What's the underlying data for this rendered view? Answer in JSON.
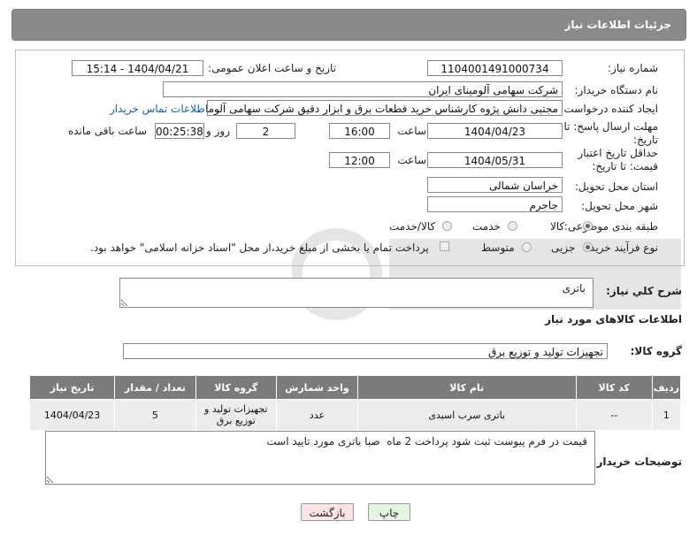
{
  "header": {
    "title": "جزئیات اطلاعات نیاز"
  },
  "form": {
    "need_number_label": "شماره نیاز:",
    "need_number": "1104001491000734",
    "announce_label": "تاریخ و ساعت اعلان عمومی:",
    "announce_value": "1404/04/21 - 15:14",
    "buyer_org_label": "نام دستگاه خریدار:",
    "buyer_org": "شرکت سهامی آلومینای ایران",
    "requester_label": "ایجاد کننده درخواست:",
    "requester": "مجتبی دانش پژوه کارشناس خرید قطعات برق و ابزار دقیق شرکت سهامی آلومینای ایران",
    "contact_link": "اطلاعات تماس خریدار",
    "reply_deadline_label": "مهلت ارسال پاسخ: تا تاریخ:",
    "reply_date": "1404/04/23",
    "time_label": "ساعت",
    "reply_time": "16:00",
    "days_value": "2",
    "days_label": "روز و",
    "remaining_value": "00:25:38",
    "remaining_label": "ساعت باقی مانده",
    "price_validity_label": "حداقل تاریخ اعتبار قیمت: تا تاریخ:",
    "price_date": "1404/05/31",
    "price_time": "12:00",
    "province_label": "استان محل تحویل:",
    "province": "خراسان شمالی",
    "city_label": "شهر محل تحویل:",
    "city": "جاجرم",
    "category_label": "طبقه بندی موضوعی:",
    "category_options": [
      "کالا",
      "خدمت",
      "کالا/خدمت"
    ],
    "category_selected": "کالا",
    "process_label": "نوع فرآیند خرید :",
    "process_options": [
      "جزیی",
      "متوسط"
    ],
    "process_selected": "جزیی",
    "treasury_note": "پرداخت تمام یا بخشی از مبلغ خرید،از محل \"اسناد خزانه اسلامی\" خواهد بود."
  },
  "description": {
    "label": "شرح كلي نياز:",
    "value": "باتری"
  },
  "goods_section": {
    "heading": "اطلاعات کالاهای مورد نیاز",
    "group_label": "گروه کالا:",
    "group_value": "تجهیزات تولید و توزیع برق"
  },
  "table": {
    "headers": [
      "ردیف",
      "کد کالا",
      "نام کالا",
      "واحد شمارش",
      "گروه کالا",
      "تعداد / مقدار",
      "تاریخ نیاز"
    ],
    "rows": [
      [
        "1",
        "--",
        "باتری سرب اسیدی",
        "عدد",
        "تجهیزات تولید و توزیع برق",
        "5",
        "1404/04/23"
      ]
    ]
  },
  "buyer_notes": {
    "label": "توضیحات خریدار:",
    "value": "قیمت در فرم پیوست ثبت شود پرداخت 2 ماه  صبا باتری مورد تایید است"
  },
  "buttons": {
    "print": "چاپ",
    "back": "بازگشت"
  },
  "colors": {
    "title_bar": "#8a8a8a",
    "table_header": "#7b7b7b",
    "link": "#1a5fa8",
    "print_button": "#e6f5e0",
    "back_button": "#fbe4e4"
  }
}
